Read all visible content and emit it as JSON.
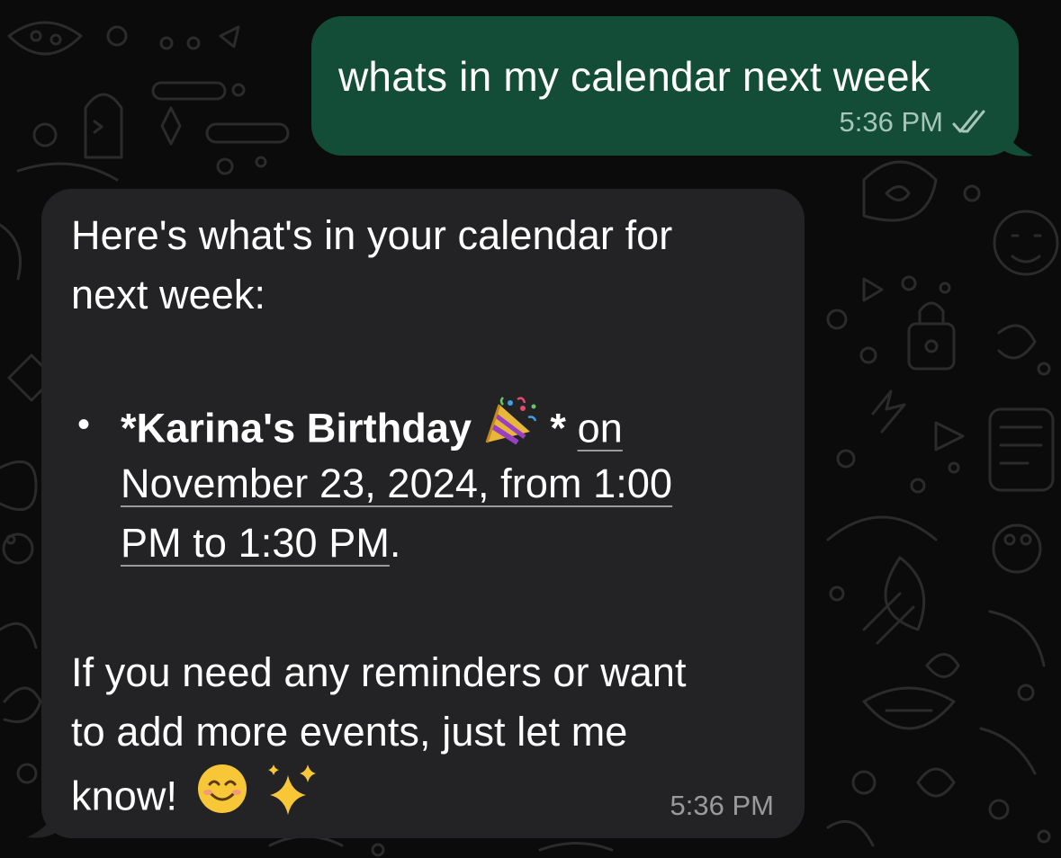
{
  "outgoing": {
    "text": "whats in my calendar next week",
    "time": "5:36 PM",
    "status_icon": "double-check-icon",
    "bubble_color": "#134d37"
  },
  "incoming": {
    "intro_line1": "Here's what's in your calendar for",
    "intro_line2": "next week:",
    "event": {
      "bullet": "•",
      "name": "*Karina's Birthday",
      "emoji_icon": "party-popper-icon",
      "name_close": "*",
      "link_line1": "on",
      "link_line2": "November 23, 2024, from 1:00",
      "link_line3": "PM to 1:30 PM",
      "period": "."
    },
    "outro_line1": "If you need any reminders or want",
    "outro_line2": "to add more events, just let me",
    "outro_line3": "know!",
    "outro_emojis": [
      "smiling-face-icon",
      "sparkles-icon"
    ],
    "time": "5:36 PM",
    "bubble_color": "#232325"
  },
  "background": {
    "color": "#0b0b0b",
    "pattern": "doodle-wallpaper"
  }
}
